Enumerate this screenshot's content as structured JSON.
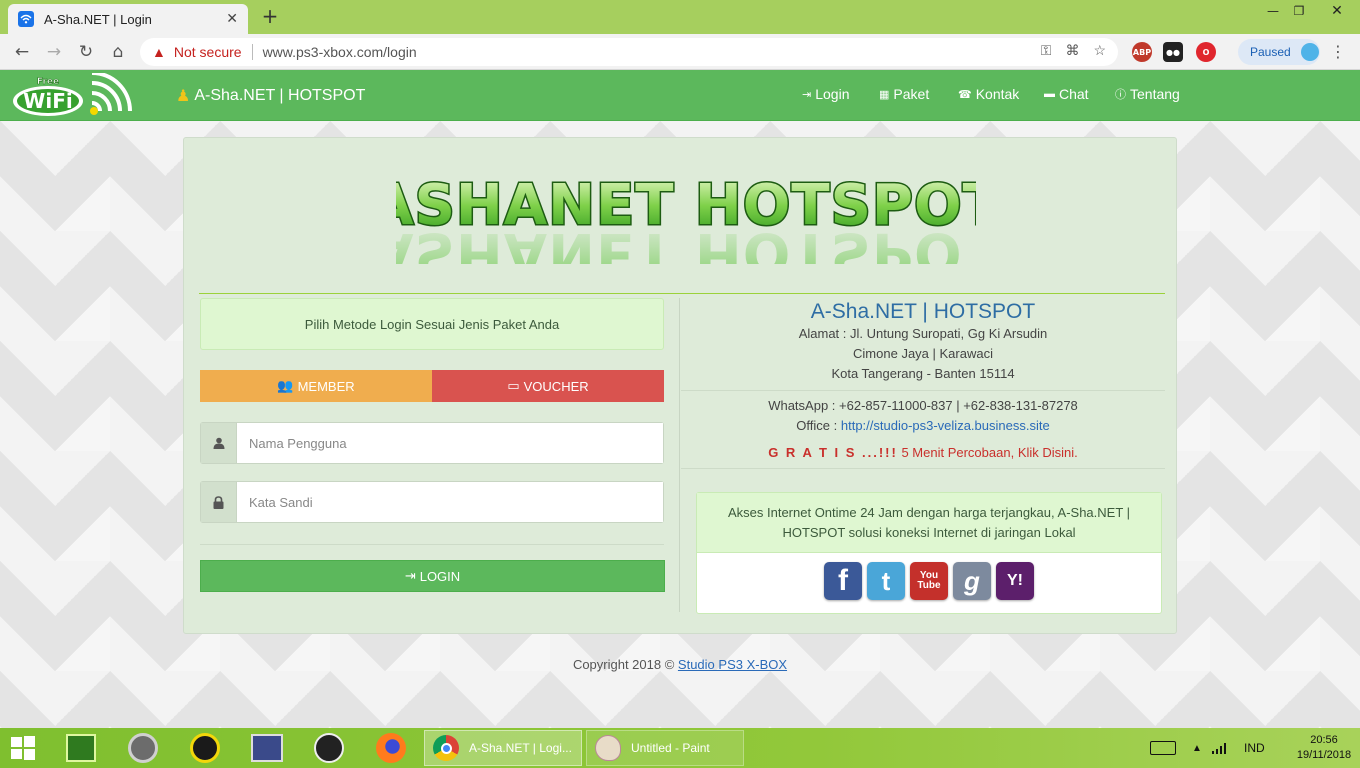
{
  "browser": {
    "tab_title": "A-Sha.NET | Login",
    "not_secure": "Not secure",
    "url": "www.ps3-xbox.com/login",
    "paused_label": "Paused",
    "ext_abp": "ABP"
  },
  "site": {
    "logo_free": "Free",
    "logo_wifi": "WiFi",
    "brand": "A-Sha.NET | HOTSPOT",
    "nav": [
      {
        "label": "Login",
        "icon": "sign-in-icon"
      },
      {
        "label": "Paket",
        "icon": "barcode-icon"
      },
      {
        "label": "Kontak",
        "icon": "phone-icon"
      },
      {
        "label": "Chat",
        "icon": "chat-icon"
      },
      {
        "label": "Tentang",
        "icon": "info-icon"
      }
    ],
    "banner_text": "ASHANET HOTSPOT"
  },
  "login": {
    "hint": "Pilih Metode Login Sesuai Jenis Paket Anda",
    "tab_member": "MEMBER",
    "tab_voucher": "VOUCHER",
    "username_placeholder": "Nama Pengguna",
    "password_placeholder": "Kata Sandi",
    "login_button": "LOGIN"
  },
  "info": {
    "title": "A-Sha.NET | HOTSPOT",
    "address_line1": "Alamat : Jl. Untung Suropati, Gg Ki Arsudin",
    "address_line2": "Cimone Jaya | Karawaci",
    "address_line3": "Kota Tangerang - Banten 15114",
    "whatsapp": "WhatsApp : +62-857-11000-837 | +62-838-131-87278",
    "office_label": "Office : ",
    "office_link": "http://studio-ps3-veliza.business.site",
    "gratis": "G R A T I S ...!!!",
    "trial_text": " 5 Menit Percobaan, ",
    "trial_link": "Klik Disini.",
    "promo": "Akses Internet Ontime 24 Jam dengan harga terjangkau, A-Sha.NET | HOTSPOT solusi koneksi Internet di jaringan Lokal",
    "social": [
      {
        "name": "facebook",
        "glyph": "f",
        "color": "#3b5998"
      },
      {
        "name": "twitter",
        "glyph": "t",
        "color": "#4aa6d8"
      },
      {
        "name": "youtube",
        "glyph": "You Tube",
        "color": "#c4302b"
      },
      {
        "name": "google",
        "glyph": "g",
        "color": "#7d8a9e"
      },
      {
        "name": "yahoo",
        "glyph": "Y!",
        "color": "#5c1f6b"
      }
    ]
  },
  "footer": {
    "copyright": "Copyright 2018 © ",
    "copyright_link": "Studio PS3 X-BOX"
  },
  "taskbar": {
    "active_window": "A-Sha.NET | Logi...",
    "paint_window": "Untitled - Paint",
    "lang": "IND",
    "time": "20:56",
    "date": "19/11/2018"
  }
}
